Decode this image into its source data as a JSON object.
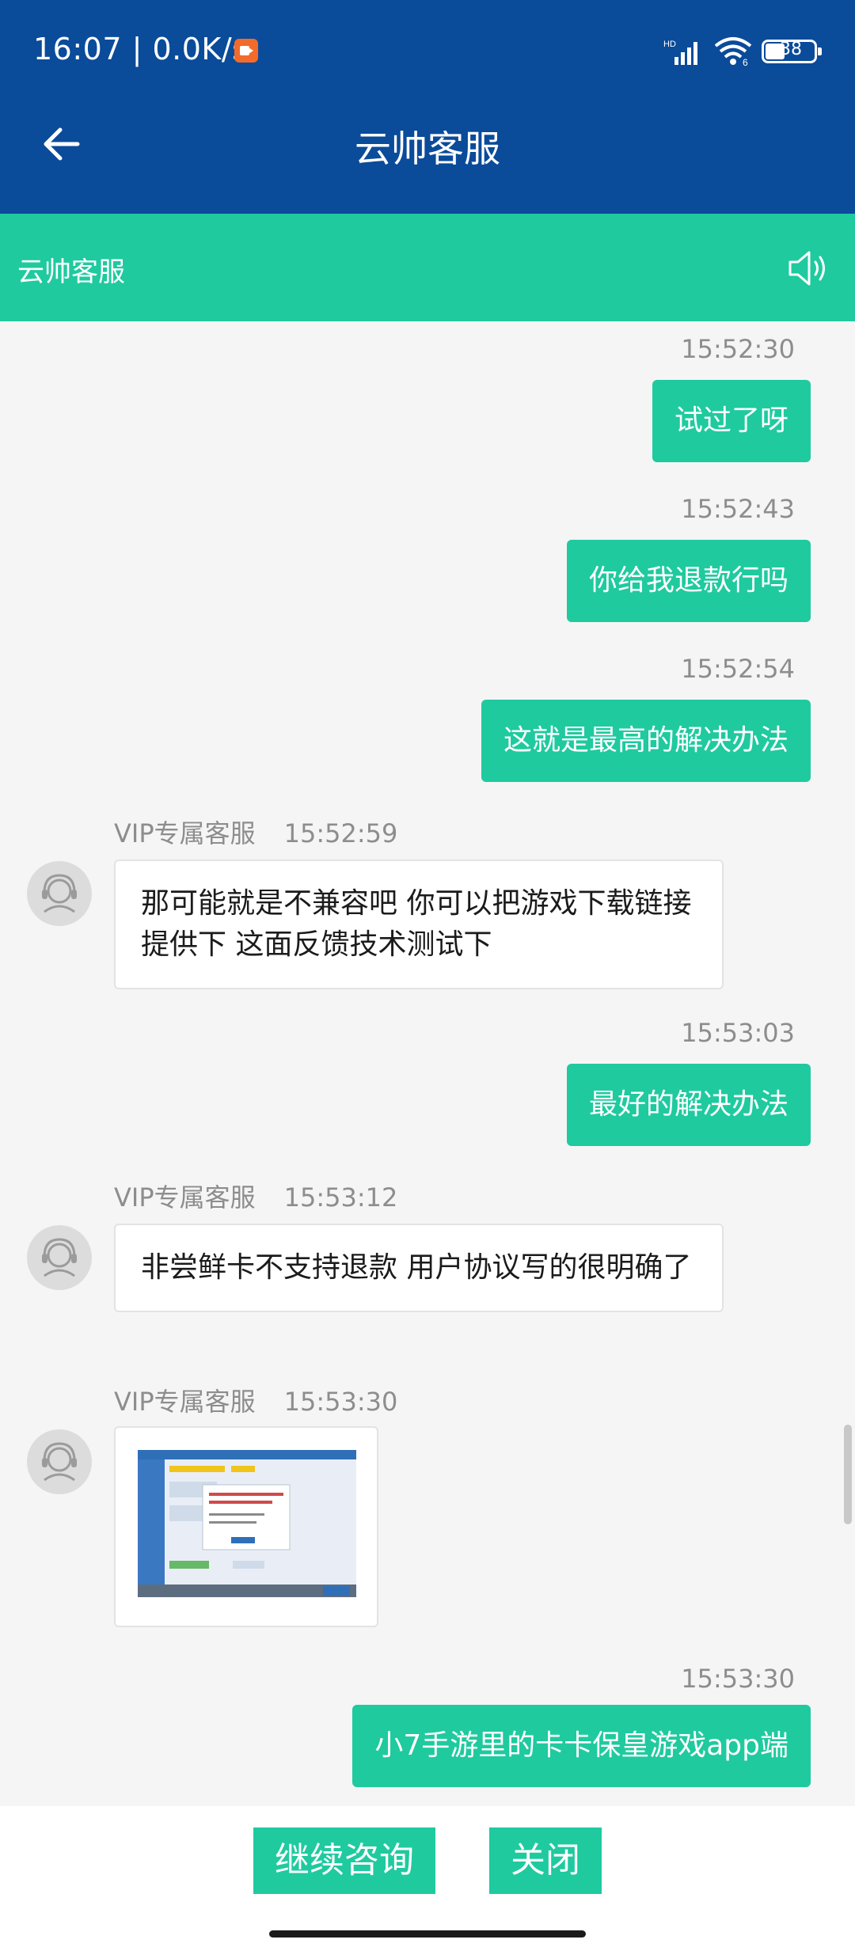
{
  "status_bar": {
    "time": "16:07 | 0.0K/s",
    "signal_badge": "HD",
    "wifi_badge": "6",
    "battery": "38"
  },
  "app_bar": {
    "title": "云帅客服",
    "back_icon": "arrow-left-icon"
  },
  "section_bar": {
    "name": "云帅客服",
    "speaker_icon": "speaker-icon"
  },
  "messages": [
    {
      "time": "15:52:30",
      "text": "试过了呀"
    },
    {
      "time": "15:52:43",
      "text": "你给我退款行吗"
    },
    {
      "time": "15:52:54",
      "text": "这就是最高的解决办法"
    },
    {
      "sender": "VIP专属客服",
      "time": "15:52:59",
      "text": "那可能就是不兼容吧 你可以把游戏下载链接提供下 这面反馈技术测试下"
    },
    {
      "time": "15:53:03",
      "text": "最好的解决办法"
    },
    {
      "sender": "VIP专属客服",
      "time": "15:53:12",
      "text": "非尝鲜卡不支持退款 用户协议写的很明确了"
    },
    {
      "sender": "VIP专属客服",
      "time": "15:53:30",
      "image": "screenshot-thumbnail"
    },
    {
      "time": "15:53:30",
      "text": "小7手游里的卡卡保皇游戏app端"
    }
  ],
  "bottom": {
    "continue_label": "继续咨询",
    "close_label": "关闭"
  },
  "colors": {
    "header": "#0a4b9a",
    "accent": "#1fca9f",
    "background": "#f5f5f5"
  }
}
